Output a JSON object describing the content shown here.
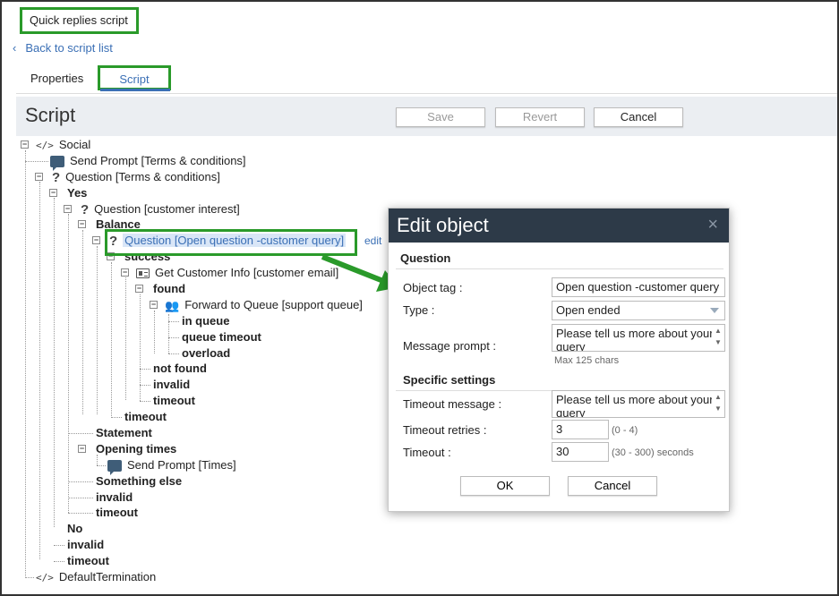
{
  "header": {
    "title": "Quick replies script",
    "back_link": "Back to script list"
  },
  "tabs": [
    {
      "label": "Properties"
    },
    {
      "label": "Script",
      "active": true
    }
  ],
  "script": {
    "title": "Script",
    "save_label": "Save",
    "revert_label": "Revert",
    "cancel_label": "Cancel"
  },
  "tree": [
    {
      "label": "Social",
      "icon": "code-icon"
    },
    {
      "label": "Send Prompt [Terms & conditions]",
      "icon": "prompt-icon"
    },
    {
      "label": "Question [Terms & conditions]",
      "icon": "question-icon"
    },
    {
      "label": "Yes"
    },
    {
      "label": "Question [customer interest]",
      "icon": "question-icon"
    },
    {
      "label": "Balance"
    },
    {
      "label": "Question [Open question -customer query]",
      "icon": "question-icon",
      "selected": true
    },
    {
      "label": "success"
    },
    {
      "label": "Get Customer Info [customer email]",
      "icon": "card-icon"
    },
    {
      "label": "found"
    },
    {
      "label": "Forward to Queue [support queue]",
      "icon": "queue-icon"
    },
    {
      "label": "in queue"
    },
    {
      "label": "queue timeout"
    },
    {
      "label": "overload"
    },
    {
      "label": "not found"
    },
    {
      "label": "invalid"
    },
    {
      "label": "timeout"
    },
    {
      "label": "timeout"
    },
    {
      "label": "Statement"
    },
    {
      "label": "Opening times"
    },
    {
      "label": "Send Prompt [Times]",
      "icon": "prompt-icon"
    },
    {
      "label": "Something else"
    },
    {
      "label": "invalid"
    },
    {
      "label": "timeout"
    },
    {
      "label": "No"
    },
    {
      "label": "invalid"
    },
    {
      "label": "timeout"
    },
    {
      "label": "DefaultTermination",
      "icon": "code-icon"
    }
  ],
  "edit_link": "edit",
  "dialog": {
    "title": "Edit object",
    "close": "×",
    "section_question": "Question",
    "object_tag_label": "Object tag :",
    "object_tag_value": "Open question -customer query",
    "type_label": "Type :",
    "type_value": "Open ended",
    "message_prompt_label": "Message prompt :",
    "message_prompt_value": "Please tell us more about your query",
    "max_chars": "Max 125 chars",
    "section_specific": "Specific settings",
    "timeout_message_label": "Timeout message :",
    "timeout_message_value": "Please tell us more about your query",
    "timeout_retries_label": "Timeout retries :",
    "timeout_retries_value": "3",
    "timeout_retries_hint": "(0 - 4)",
    "timeout_label": "Timeout :",
    "timeout_value": "30",
    "timeout_hint": "(30 - 300) seconds",
    "ok_label": "OK",
    "cancel_label": "Cancel"
  },
  "colors": {
    "highlight": "#2a9a2a",
    "link": "#3a6fb5",
    "dialog_header": "#2d3a48"
  }
}
